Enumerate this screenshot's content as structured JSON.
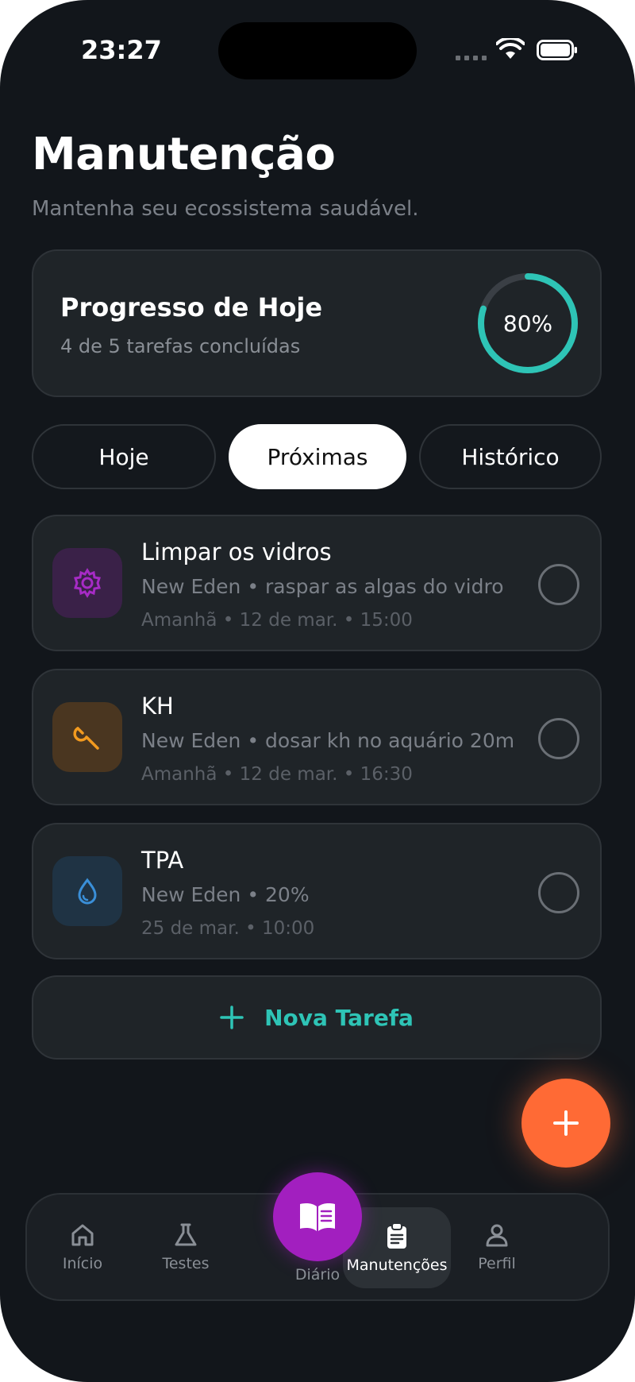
{
  "status_bar": {
    "time": "23:27"
  },
  "header": {
    "title": "Manutenção",
    "subtitle": "Mantenha seu ecossistema saudável."
  },
  "progress": {
    "title": "Progresso de Hoje",
    "subtitle": "4 de 5 tarefas concluídas",
    "percent_label": "80%",
    "fraction": 0.8,
    "ring_color": "#2ec4b6"
  },
  "tabs": [
    {
      "label": "Hoje",
      "active": false
    },
    {
      "label": "Próximas",
      "active": true
    },
    {
      "label": "Histórico",
      "active": false
    }
  ],
  "tasks": [
    {
      "title": "Limpar os vidros",
      "description": "New Eden • raspar as algas do vidro",
      "date": "Amanhã • 12 de mar. • 15:00",
      "icon": "gear-icon",
      "icon_color": "#a62bc5"
    },
    {
      "title": "KH",
      "description": "New Eden • dosar kh no aquário 20m",
      "date": "Amanhã • 12 de mar. • 16:30",
      "icon": "wrench-icon",
      "icon_color": "#f29a1f"
    },
    {
      "title": "TPA",
      "description": "New Eden • 20%",
      "date": "25 de mar. • 10:00",
      "icon": "water-drop-icon",
      "icon_color": "#3a8fd8"
    }
  ],
  "new_task": {
    "label": "Nova Tarefa",
    "color": "#2ec4b6"
  },
  "fab": {
    "icon": "plus-icon",
    "color": "#ff6a35"
  },
  "nav": {
    "items": [
      {
        "label": "Início",
        "icon": "home-icon",
        "active": false
      },
      {
        "label": "Testes",
        "icon": "flask-icon",
        "active": false
      },
      {
        "label": "Diário",
        "icon": "book-icon",
        "active": false
      },
      {
        "label": "Manutenções",
        "icon": "clipboard-icon",
        "active": true
      },
      {
        "label": "Perfil",
        "icon": "user-icon",
        "active": false
      }
    ]
  }
}
